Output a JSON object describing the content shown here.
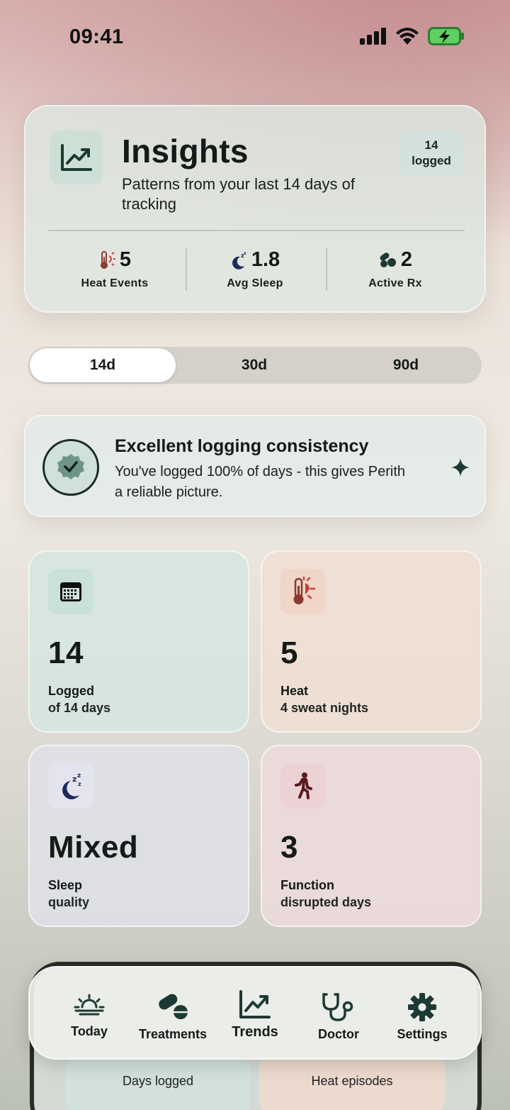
{
  "status_bar": {
    "time": "09:41"
  },
  "header": {
    "icon": "trend-chart-icon",
    "title": "Insights",
    "subtitle": "Patterns from your last 14 days of tracking",
    "badge": {
      "line1": "14",
      "line2": "logged"
    },
    "stats": [
      {
        "icon": "thermometer-sun-icon",
        "value": "5",
        "label": "Heat Events"
      },
      {
        "icon": "moon-sleep-icon",
        "value": "1.8",
        "label": "Avg Sleep"
      },
      {
        "icon": "pills-icon",
        "value": "2",
        "label": "Active Rx"
      }
    ]
  },
  "range_selector": {
    "options": [
      "14d",
      "30d",
      "90d"
    ],
    "selected": "14d"
  },
  "consistency": {
    "icon": "badge-check-icon",
    "title": "Excellent logging consistency",
    "body": "You've logged 100% of days - this gives Perith a reliable picture.",
    "action_icon": "sparkle-icon"
  },
  "tiles": [
    {
      "icon": "calendar-icon",
      "value": "14",
      "line1": "Logged",
      "line2": "of 14 days",
      "color": "#d6e6e0"
    },
    {
      "icon": "thermometer-sun-icon",
      "value": "5",
      "line1": "Heat",
      "line2": "4 sweat nights",
      "color": "#efdfd4"
    },
    {
      "icon": "moon-sleep-icon",
      "value": "Mixed",
      "line1": "Sleep",
      "line2": "quality",
      "color": "#dfe0e6"
    },
    {
      "icon": "walking-icon",
      "value": "3",
      "line1": "Function",
      "line2": "disrupted days",
      "color": "#ecdada"
    }
  ],
  "behind_tiles": [
    "Days logged",
    "Heat episodes"
  ],
  "nav": {
    "items": [
      {
        "icon": "sunrise-icon",
        "label": "Today"
      },
      {
        "icon": "pills-icon",
        "label": "Treatments"
      },
      {
        "icon": "trend-chart-icon",
        "label": "Trends"
      },
      {
        "icon": "stethoscope-icon",
        "label": "Doctor"
      },
      {
        "icon": "gear-icon",
        "label": "Settings"
      }
    ],
    "active": "Trends"
  },
  "colors": {
    "accent": "#1c3a33",
    "heat": "#8a3a32"
  }
}
